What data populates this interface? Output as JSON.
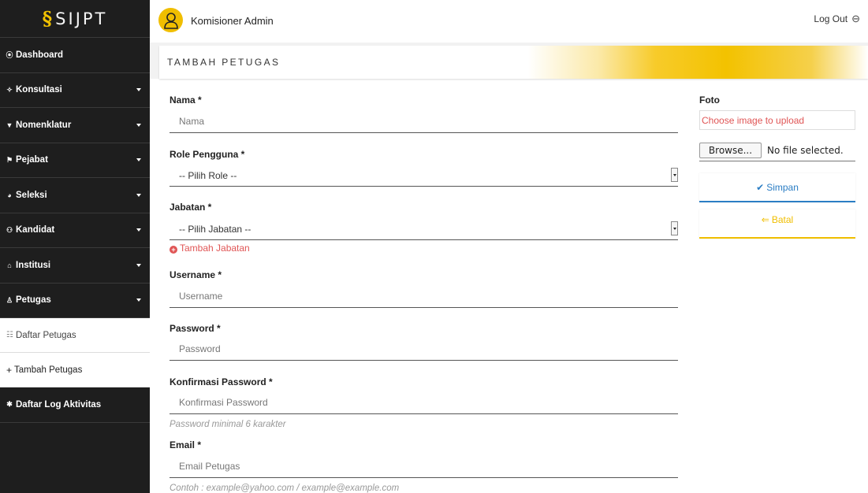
{
  "app": {
    "logo_mark": "§",
    "logo_text": "SIJPT"
  },
  "sidebar": {
    "items": [
      {
        "label": "Dashboard",
        "icon": "⦿"
      },
      {
        "label": "Konsultasi",
        "icon": "✧"
      },
      {
        "label": "Nomenklatur",
        "icon": "▼"
      },
      {
        "label": "Pejabat",
        "icon": "⚑"
      },
      {
        "label": "Seleksi",
        "icon": "◕"
      },
      {
        "label": "Kandidat",
        "icon": "⚇"
      },
      {
        "label": "Institusi",
        "icon": "⌂"
      },
      {
        "label": "Petugas",
        "icon": "♙"
      }
    ],
    "sub_items": [
      {
        "label": "Daftar Petugas",
        "icon": "☷"
      },
      {
        "label": "Tambah Petugas",
        "icon": "+"
      }
    ],
    "log_item": {
      "label": "Daftar Log Aktivitas",
      "icon": "✱"
    }
  },
  "topbar": {
    "user": "Komisioner Admin",
    "logout": "Log Out",
    "logout_icon": "⊖"
  },
  "page": {
    "title": "TAMBAH PETUGAS"
  },
  "form": {
    "nama": {
      "label": "Nama *",
      "placeholder": "Nama"
    },
    "role": {
      "label": "Role Pengguna *",
      "selected": "-- Pilih Role --"
    },
    "jabatan": {
      "label": "Jabatan *",
      "selected": "-- Pilih Jabatan --",
      "add_link": "Tambah Jabatan"
    },
    "username": {
      "label": "Username *",
      "placeholder": "Username"
    },
    "password": {
      "label": "Password *",
      "placeholder": "Password"
    },
    "konfirmasi": {
      "label": "Konfirmasi Password *",
      "placeholder": "Konfirmasi Password",
      "help": "Password minimal 6 karakter"
    },
    "email": {
      "label": "Email *",
      "placeholder": "Email Petugas",
      "help": "Contoh : example@yahoo.com / example@example.com"
    }
  },
  "foto": {
    "label": "Foto",
    "placeholder": "Choose image to upload",
    "browse": "Browse...",
    "file_status": "No file selected."
  },
  "buttons": {
    "simpan": "Simpan",
    "simpan_icon": "✔",
    "batal": "Batal",
    "batal_icon": "⇐"
  },
  "colors": {
    "accent_yellow": "#f0be00",
    "accent_blue": "#2a7dc4",
    "error_red": "#e05555",
    "sidebar_bg": "#1e1e1e"
  }
}
